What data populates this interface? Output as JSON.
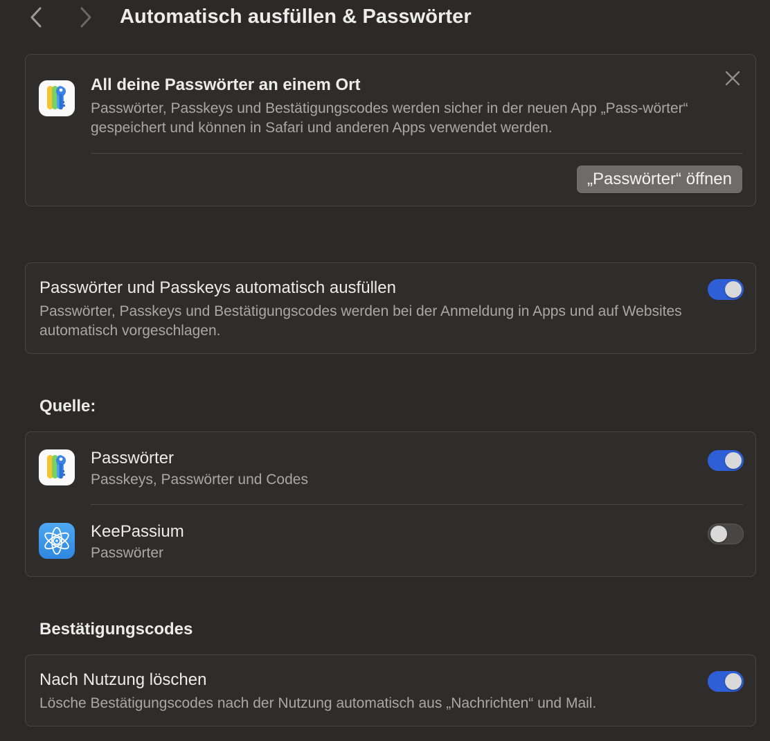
{
  "header": {
    "title": "Automatisch ausfüllen & Passwörter"
  },
  "banner": {
    "title": "All deine Passwörter an einem Ort",
    "text": "Passwörter, Passkeys und Bestätigungscodes werden sicher in der neuen App „Pass-wörter“ gespeichert und können in Safari und anderen Apps verwendet werden.",
    "open_button_label": "„Passwörter“ öffnen"
  },
  "autofill": {
    "title": "Passwörter und Passkeys automatisch ausfüllen",
    "description": "Passwörter, Passkeys und Bestätigungscodes werden bei der Anmeldung in Apps und auf Websites automatisch vorgeschlagen.",
    "enabled": true
  },
  "sources": {
    "header": "Quelle:",
    "items": [
      {
        "name": "Passwörter",
        "subtitle": "Passkeys, Passwörter und Codes",
        "icon": "passwords-app-icon",
        "enabled": true
      },
      {
        "name": "KeePassium",
        "subtitle": "Passwörter",
        "icon": "keepassium-app-icon",
        "enabled": false
      }
    ]
  },
  "codes": {
    "header": "Bestätigungscodes",
    "title": "Nach Nutzung löschen",
    "description": "Lösche Bestätigungscodes nach der Nutzung automatisch aus „Nachrichten“ und Mail.",
    "enabled": true
  },
  "colors": {
    "background": "#2b2a29",
    "card": "#2e2d2c",
    "toggle_on": "#2e5fd6",
    "toggle_off": "#474645",
    "secondary_text": "#a9a8a6"
  }
}
